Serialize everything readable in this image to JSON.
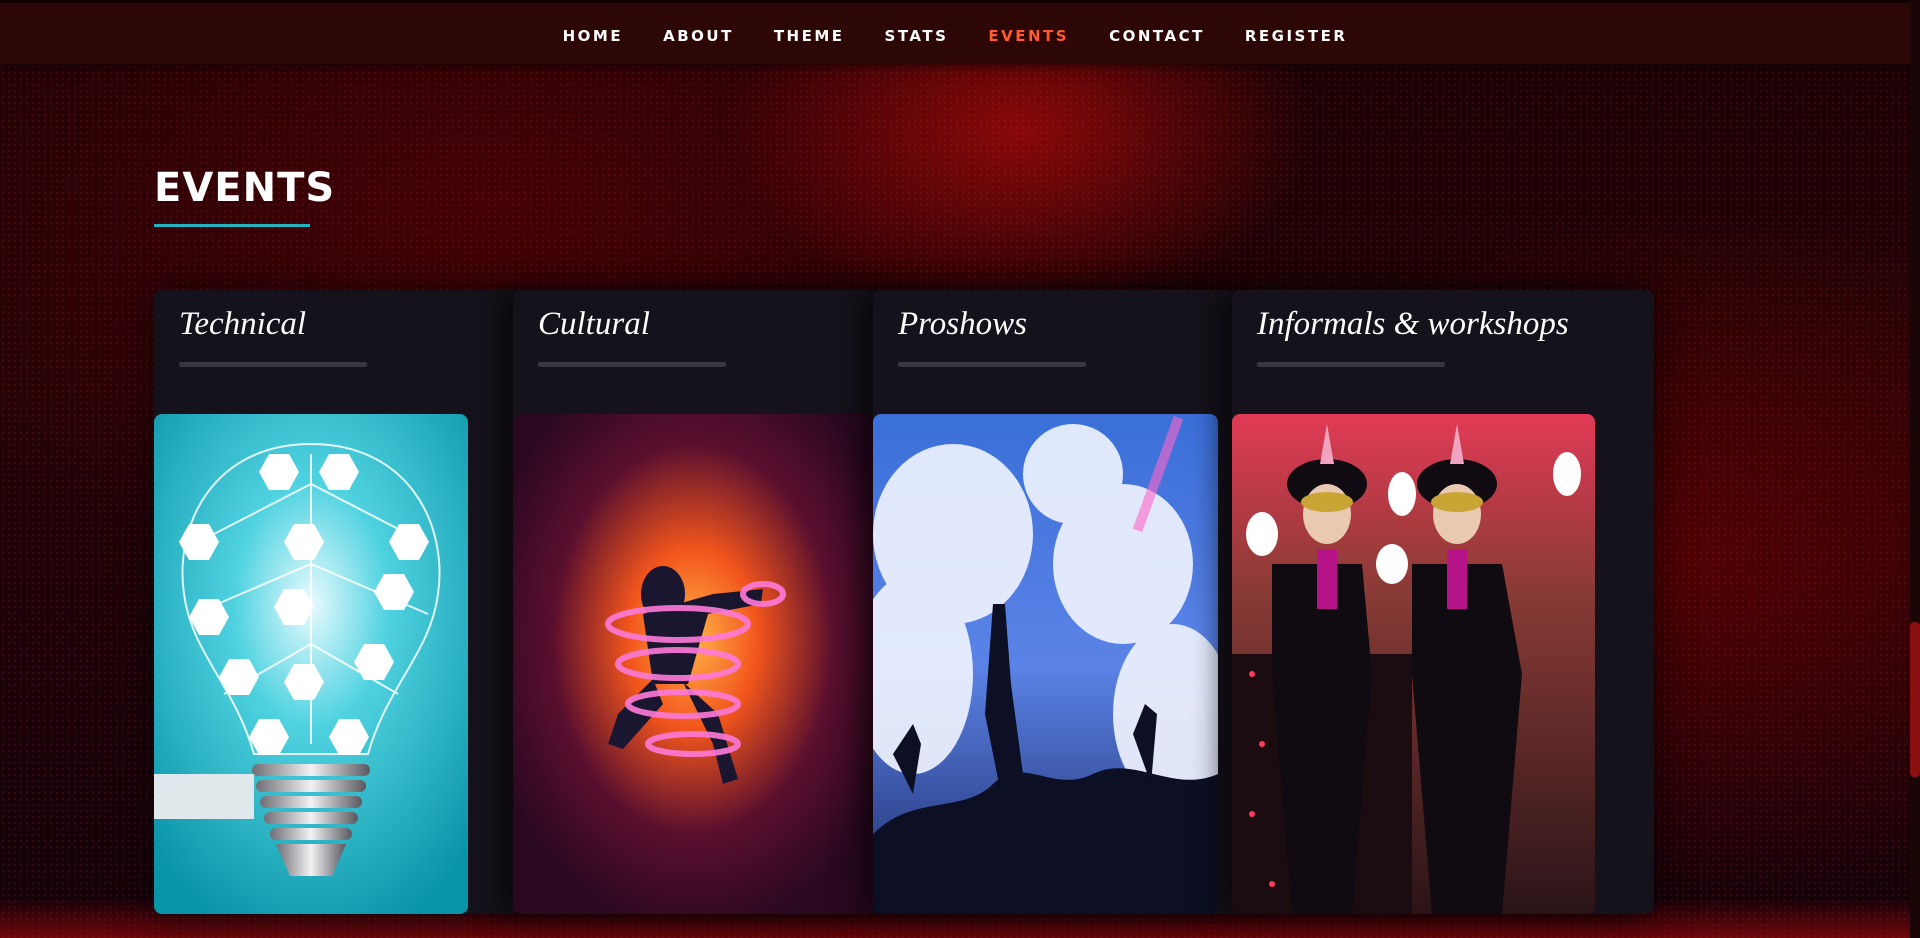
{
  "nav": {
    "items": [
      {
        "label": "HOME",
        "active": false
      },
      {
        "label": "ABOUT",
        "active": false
      },
      {
        "label": "THEME",
        "active": false
      },
      {
        "label": "STATS",
        "active": false
      },
      {
        "label": "EVENTS",
        "active": true
      },
      {
        "label": "CONTACT",
        "active": false
      },
      {
        "label": "REGISTER",
        "active": false
      }
    ]
  },
  "section": {
    "title": "EVENTS"
  },
  "cards": [
    {
      "title": "Technical",
      "image": "lightbulb-science-icons-image"
    },
    {
      "title": "Cultural",
      "image": "fire-dancer-image"
    },
    {
      "title": "Proshows",
      "image": "concert-crowd-image"
    },
    {
      "title": "Informals & workshops",
      "image": "jesters-image"
    }
  ],
  "colors": {
    "nav_bg": "#2d0606",
    "nav_active": "#ff5b2e",
    "underline": "#20b5c0",
    "card_bg": "#16121b"
  }
}
